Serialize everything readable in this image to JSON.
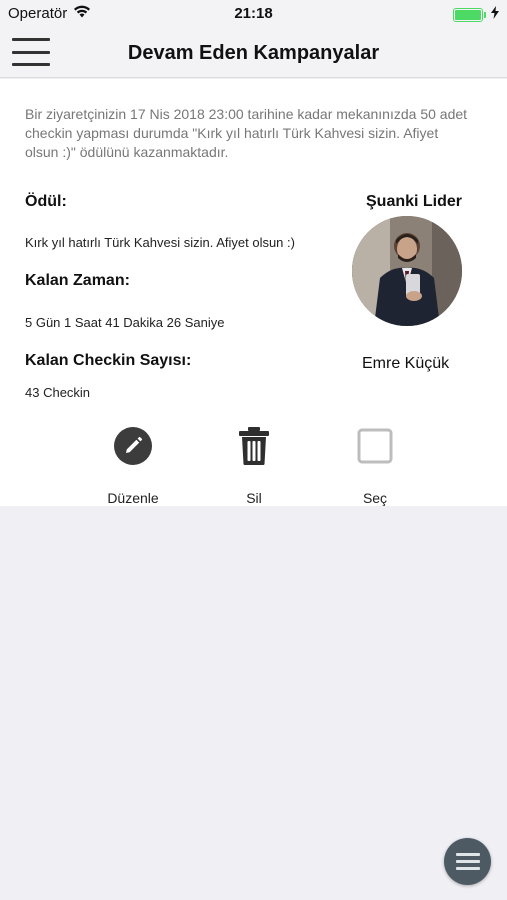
{
  "status_bar": {
    "carrier": "Operatör",
    "time": "21:18"
  },
  "nav": {
    "title": "Devam Eden Kampanyalar",
    "menu_icon": "hamburger-menu-icon"
  },
  "campaign": {
    "description": "Bir ziyaretçinizin 17 Nis 2018 23:00 tarihine kadar mekanınızda 50 adet checkin yapması durumda \"Kırk yıl hatırlı Türk Kahvesi sizin. Afiyet olsun :)\" ödülünü kazanmaktadır.",
    "reward_label": "Ödül:",
    "reward_value": "Kırk yıl hatırlı Türk Kahvesi sizin. Afiyet olsun :)",
    "time_label": "Kalan Zaman:",
    "time_value": "5 Gün 1  Saat 41  Dakika 26  Saniye",
    "checkin_label": "Kalan Checkin Sayısı:",
    "checkin_value": "43 Checkin"
  },
  "leader": {
    "title": "Şuanki Lider",
    "name": "Emre Küçük"
  },
  "actions": {
    "edit_label": "Düzenle",
    "delete_label": "Sil",
    "select_label": "Seç"
  },
  "colors": {
    "accent": "#4d5a63",
    "battery": "#4cd964",
    "edit_icon_bg": "#3c3c3c"
  }
}
